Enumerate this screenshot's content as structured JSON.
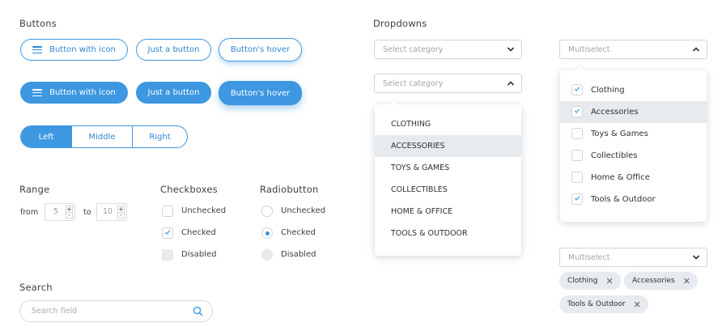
{
  "sections": {
    "buttons": "Buttons",
    "dropdowns": "Dropdowns",
    "range": "Range",
    "checkboxes": "Checkboxes",
    "radiobutton": "Radiobutton",
    "search": "Search"
  },
  "buttons": {
    "outline": [
      "Button with icon",
      "Just a button",
      "Button's hover"
    ],
    "filled": [
      "Button with icon",
      "Just a button",
      "Button's hover"
    ],
    "icon": "menu-icon"
  },
  "segmented": [
    "Left",
    "Middle",
    "Right"
  ],
  "range": {
    "from_label": "from",
    "from_value": "5",
    "to_label": "to",
    "to_value": "10",
    "plus": "+",
    "minus": "-"
  },
  "checkboxes": [
    {
      "label": "Unchecked",
      "state": "unchecked"
    },
    {
      "label": "Checked",
      "state": "checked"
    },
    {
      "label": "Disabled",
      "state": "disabled"
    }
  ],
  "radios": [
    {
      "label": "Unchecked",
      "state": "unchecked"
    },
    {
      "label": "Checked",
      "state": "checked"
    },
    {
      "label": "Disabled",
      "state": "disabled"
    }
  ],
  "search": {
    "placeholder": "Search field",
    "icon": "search-icon"
  },
  "dropdown_closed": {
    "placeholder": "Select category"
  },
  "dropdown_open": {
    "placeholder": "Select category",
    "options": [
      "CLOTHING",
      "ACCESSORIES",
      "TOYS & GAMES",
      "COLLECTIBLES",
      "HOME & OFFICE",
      "TOOLS & OUTDOOR"
    ],
    "highlighted": 1
  },
  "multiselect_open": {
    "placeholder": "Multiselect",
    "options": [
      {
        "label": "Clothing",
        "checked": true
      },
      {
        "label": "Accessories",
        "checked": true
      },
      {
        "label": "Toys & Games",
        "checked": false
      },
      {
        "label": "Collectibles",
        "checked": false
      },
      {
        "label": "Home & Office",
        "checked": false
      },
      {
        "label": "Tools & Outdoor",
        "checked": true
      }
    ],
    "highlighted": 1
  },
  "multiselect_closed": {
    "placeholder": "Multiselect",
    "tags": [
      "Clothing",
      "Accessories",
      "Tools & Outdoor"
    ],
    "remove": "✕"
  },
  "colors": {
    "accent": "#3d97e1",
    "highlight": "#e7eaee",
    "border": "#cfd4da"
  }
}
